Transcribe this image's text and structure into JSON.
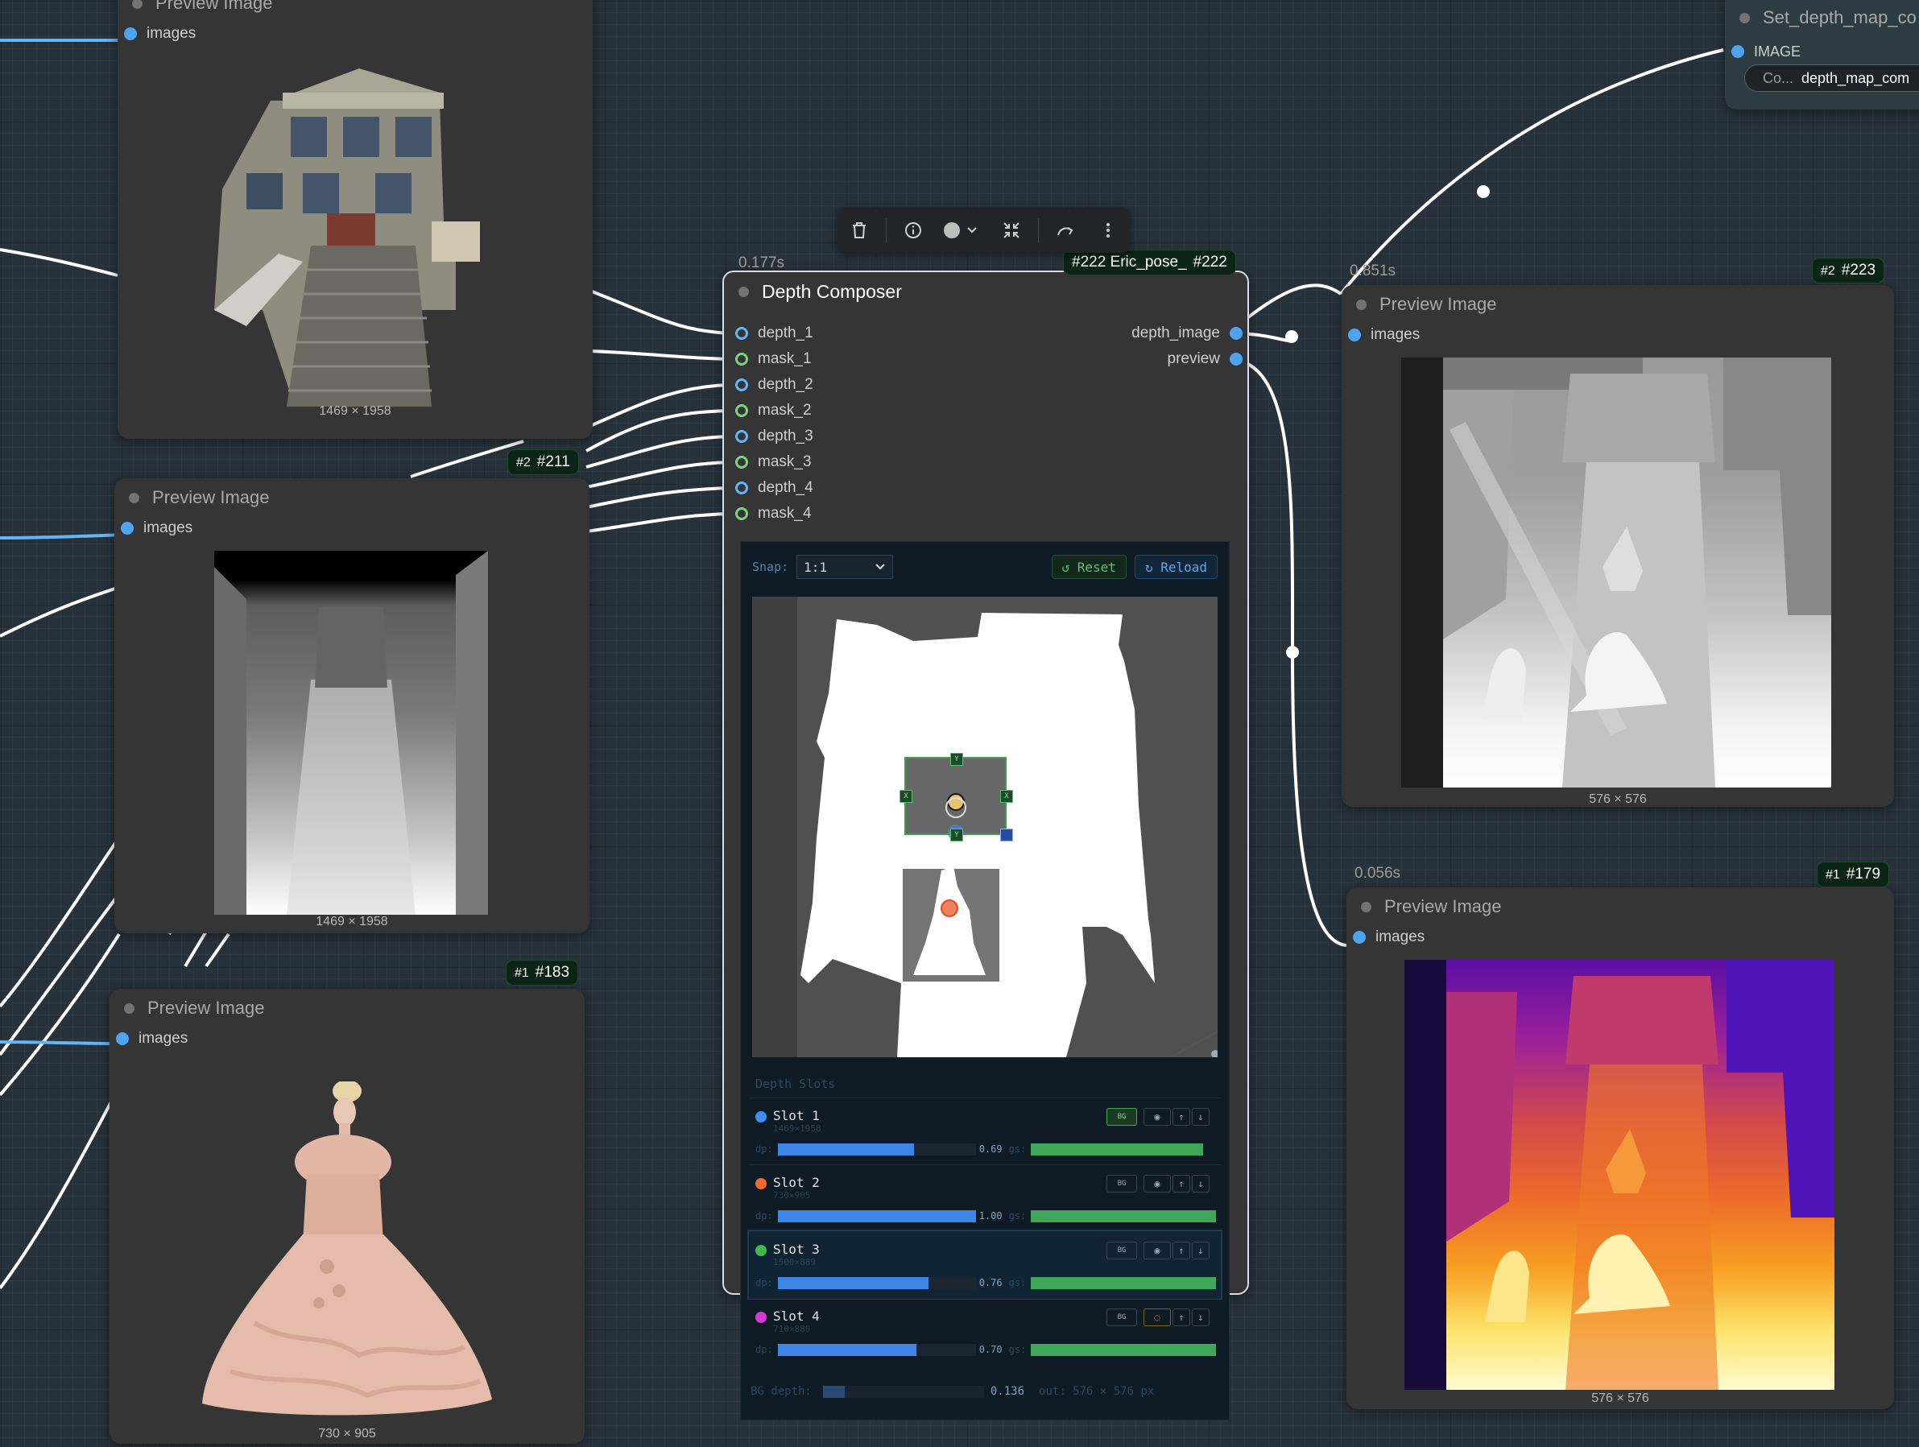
{
  "nodes": {
    "preview_house": {
      "title": "Preview Image",
      "input": "images",
      "dims": "1469 × 1958"
    },
    "preview_depth": {
      "title": "Preview Image",
      "input": "images",
      "dims": "1469 × 1958",
      "badge_sub": "#2",
      "badge": "#211"
    },
    "preview_dress": {
      "title": "Preview Image",
      "input": "images",
      "dims": "730 × 905",
      "badge_sub": "#1",
      "badge": "#183"
    },
    "set_depth": {
      "title": "Set_depth_map_co",
      "input": "IMAGE",
      "widget_label": "Co...",
      "widget_value": "depth_map_com"
    },
    "preview_out": {
      "title": "Preview Image",
      "input": "images",
      "dims": "576 × 576",
      "timing": "0.851s",
      "badge_sub": "#2",
      "badge": "#223"
    },
    "preview_color": {
      "title": "Preview Image",
      "input": "images",
      "dims": "576 × 576",
      "timing": "0.056s",
      "badge_sub": "#1",
      "badge": "#179"
    }
  },
  "composer": {
    "title": "Depth Composer",
    "timing": "0.177s",
    "badge_label": "#222 Eric_pose_",
    "badge_id": "#222",
    "inputs": [
      "depth_1",
      "mask_1",
      "depth_2",
      "mask_2",
      "depth_3",
      "mask_3",
      "depth_4",
      "mask_4"
    ],
    "outputs": [
      "depth_image",
      "preview"
    ],
    "snap_label": "Snap:",
    "snap_value": "1:1",
    "reset_label": "↺ Reset",
    "reload_label": "↻ Reload",
    "slots_title": "Depth Slots",
    "slots": [
      {
        "name": "Slot 1",
        "dims": "1469×1958",
        "color": "#3d8ef0",
        "dp": 0.69,
        "dp_text": "0.69",
        "bg_active": true,
        "hidden": false
      },
      {
        "name": "Slot 2",
        "dims": "730×905",
        "color": "#f06a30",
        "dp": 1.0,
        "dp_text": "1.00",
        "bg_active": false,
        "hidden": false
      },
      {
        "name": "Slot 3",
        "dims": "1500×889",
        "color": "#3eb84f",
        "dp": 0.76,
        "dp_text": "0.76",
        "bg_active": false,
        "hidden": false
      },
      {
        "name": "Slot 4",
        "dims": "710×880",
        "color": "#d63ad6",
        "dp": 0.7,
        "dp_text": "0.70",
        "bg_active": false,
        "hidden": true
      }
    ],
    "labels": {
      "dp": "dp:",
      "gs": "gs:",
      "bg_btn": "BG"
    },
    "bg_depth_label": "BG depth:",
    "bg_depth_value": 0.136,
    "bg_depth_text": "0.136",
    "out_text": "out: 576 × 576 px",
    "handles": {
      "y": "Y",
      "x": "X"
    }
  },
  "toolbar": {
    "icons": [
      "trash-icon",
      "info-icon",
      "color-icon",
      "collapse-icon",
      "bypass-icon",
      "more-icon"
    ]
  },
  "colors": {
    "canvas_bg": "#27313a",
    "node_bg": "#353535",
    "link_blue": "#64b5f6",
    "link_white": "#ffffff",
    "badge_bg": "#0b2416"
  }
}
